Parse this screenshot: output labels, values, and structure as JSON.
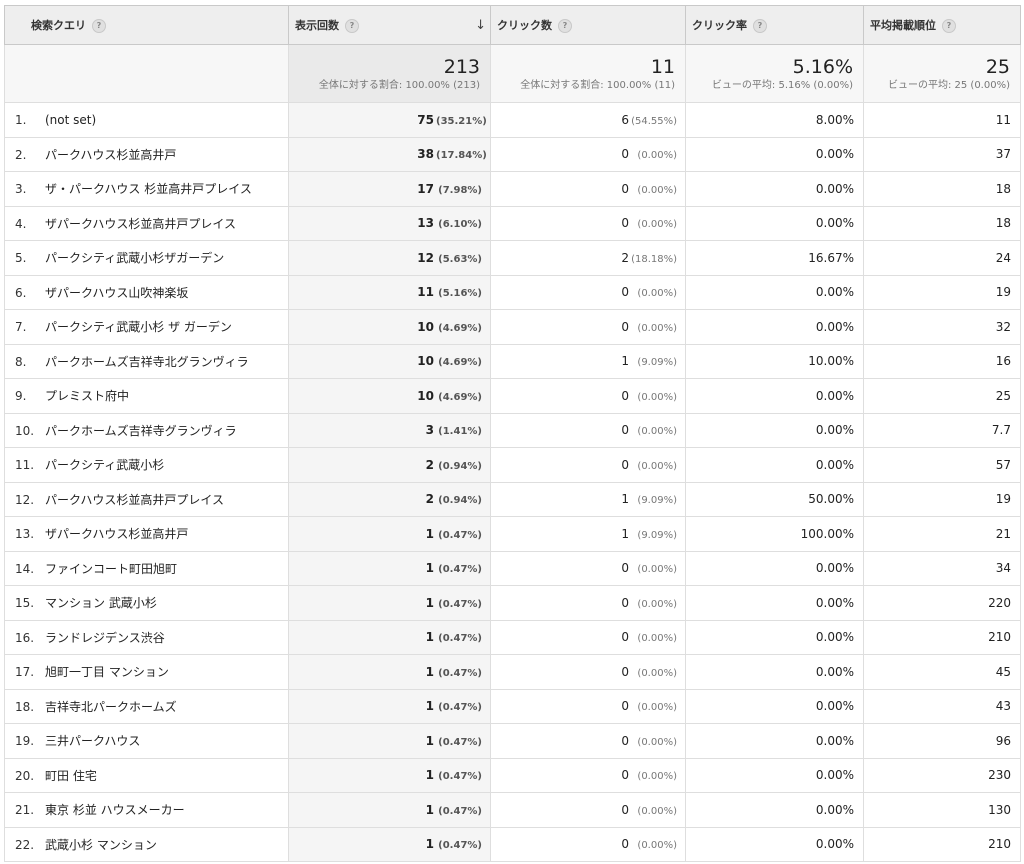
{
  "columns": {
    "query": "検索クエリ",
    "impressions": "表示回数",
    "clicks": "クリック数",
    "ctr": "クリック率",
    "position": "平均掲載順位"
  },
  "help_glyph": "?",
  "sort_glyph": "↓",
  "totals": {
    "impressions": {
      "value": "213",
      "sub": "全体に対する割合: 100.00% (213)"
    },
    "clicks": {
      "value": "11",
      "sub": "全体に対する割合: 100.00% (11)"
    },
    "ctr": {
      "value": "5.16%",
      "sub": "ビューの平均: 5.16% (0.00%)"
    },
    "position": {
      "value": "25",
      "sub": "ビューの平均: 25 (0.00%)"
    }
  },
  "rows": [
    {
      "n": "1.",
      "query": "(not set)",
      "imp": "75",
      "imp_pct": "(35.21%)",
      "clk": "6",
      "clk_pct": "(54.55%)",
      "ctr": "8.00%",
      "pos": "11"
    },
    {
      "n": "2.",
      "query": "パークハウス杉並高井戸",
      "imp": "38",
      "imp_pct": "(17.84%)",
      "clk": "0",
      "clk_pct": "(0.00%)",
      "ctr": "0.00%",
      "pos": "37"
    },
    {
      "n": "3.",
      "query": "ザ・パークハウス 杉並高井戸プレイス",
      "imp": "17",
      "imp_pct": "(7.98%)",
      "clk": "0",
      "clk_pct": "(0.00%)",
      "ctr": "0.00%",
      "pos": "18"
    },
    {
      "n": "4.",
      "query": "ザパークハウス杉並高井戸プレイス",
      "imp": "13",
      "imp_pct": "(6.10%)",
      "clk": "0",
      "clk_pct": "(0.00%)",
      "ctr": "0.00%",
      "pos": "18"
    },
    {
      "n": "5.",
      "query": "パークシティ武蔵小杉ザガーデン",
      "imp": "12",
      "imp_pct": "(5.63%)",
      "clk": "2",
      "clk_pct": "(18.18%)",
      "ctr": "16.67%",
      "pos": "24"
    },
    {
      "n": "6.",
      "query": "ザパークハウス山吹神楽坂",
      "imp": "11",
      "imp_pct": "(5.16%)",
      "clk": "0",
      "clk_pct": "(0.00%)",
      "ctr": "0.00%",
      "pos": "19"
    },
    {
      "n": "7.",
      "query": "パークシティ武蔵小杉 ザ ガーデン",
      "imp": "10",
      "imp_pct": "(4.69%)",
      "clk": "0",
      "clk_pct": "(0.00%)",
      "ctr": "0.00%",
      "pos": "32"
    },
    {
      "n": "8.",
      "query": "パークホームズ吉祥寺北グランヴィラ",
      "imp": "10",
      "imp_pct": "(4.69%)",
      "clk": "1",
      "clk_pct": "(9.09%)",
      "ctr": "10.00%",
      "pos": "16"
    },
    {
      "n": "9.",
      "query": "プレミスト府中",
      "imp": "10",
      "imp_pct": "(4.69%)",
      "clk": "0",
      "clk_pct": "(0.00%)",
      "ctr": "0.00%",
      "pos": "25"
    },
    {
      "n": "10.",
      "query": "パークホームズ吉祥寺グランヴィラ",
      "imp": "3",
      "imp_pct": "(1.41%)",
      "clk": "0",
      "clk_pct": "(0.00%)",
      "ctr": "0.00%",
      "pos": "7.7"
    },
    {
      "n": "11.",
      "query": "パークシティ武蔵小杉",
      "imp": "2",
      "imp_pct": "(0.94%)",
      "clk": "0",
      "clk_pct": "(0.00%)",
      "ctr": "0.00%",
      "pos": "57"
    },
    {
      "n": "12.",
      "query": "パークハウス杉並高井戸プレイス",
      "imp": "2",
      "imp_pct": "(0.94%)",
      "clk": "1",
      "clk_pct": "(9.09%)",
      "ctr": "50.00%",
      "pos": "19"
    },
    {
      "n": "13.",
      "query": "ザパークハウス杉並高井戸",
      "imp": "1",
      "imp_pct": "(0.47%)",
      "clk": "1",
      "clk_pct": "(9.09%)",
      "ctr": "100.00%",
      "pos": "21"
    },
    {
      "n": "14.",
      "query": "ファインコート町田旭町",
      "imp": "1",
      "imp_pct": "(0.47%)",
      "clk": "0",
      "clk_pct": "(0.00%)",
      "ctr": "0.00%",
      "pos": "34"
    },
    {
      "n": "15.",
      "query": "マンション 武蔵小杉",
      "imp": "1",
      "imp_pct": "(0.47%)",
      "clk": "0",
      "clk_pct": "(0.00%)",
      "ctr": "0.00%",
      "pos": "220"
    },
    {
      "n": "16.",
      "query": "ランドレジデンス渋谷",
      "imp": "1",
      "imp_pct": "(0.47%)",
      "clk": "0",
      "clk_pct": "(0.00%)",
      "ctr": "0.00%",
      "pos": "210"
    },
    {
      "n": "17.",
      "query": "旭町一丁目 マンション",
      "imp": "1",
      "imp_pct": "(0.47%)",
      "clk": "0",
      "clk_pct": "(0.00%)",
      "ctr": "0.00%",
      "pos": "45"
    },
    {
      "n": "18.",
      "query": "吉祥寺北パークホームズ",
      "imp": "1",
      "imp_pct": "(0.47%)",
      "clk": "0",
      "clk_pct": "(0.00%)",
      "ctr": "0.00%",
      "pos": "43"
    },
    {
      "n": "19.",
      "query": "三井パークハウス",
      "imp": "1",
      "imp_pct": "(0.47%)",
      "clk": "0",
      "clk_pct": "(0.00%)",
      "ctr": "0.00%",
      "pos": "96"
    },
    {
      "n": "20.",
      "query": "町田 住宅",
      "imp": "1",
      "imp_pct": "(0.47%)",
      "clk": "0",
      "clk_pct": "(0.00%)",
      "ctr": "0.00%",
      "pos": "230"
    },
    {
      "n": "21.",
      "query": "東京 杉並 ハウスメーカー",
      "imp": "1",
      "imp_pct": "(0.47%)",
      "clk": "0",
      "clk_pct": "(0.00%)",
      "ctr": "0.00%",
      "pos": "130"
    },
    {
      "n": "22.",
      "query": "武蔵小杉 マンション",
      "imp": "1",
      "imp_pct": "(0.47%)",
      "clk": "0",
      "clk_pct": "(0.00%)",
      "ctr": "0.00%",
      "pos": "210"
    }
  ]
}
